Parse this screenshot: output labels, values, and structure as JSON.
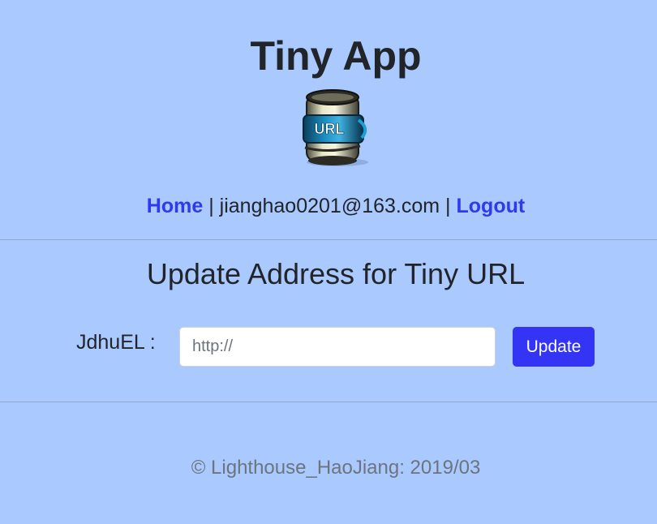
{
  "header": {
    "title": "Tiny App",
    "logo_icon": "url-barrel-icon",
    "logo_text": "URL"
  },
  "nav": {
    "home_label": "Home",
    "separator": "|",
    "user_email": "jianghao0201@163.com",
    "logout_label": "Logout"
  },
  "main": {
    "heading": "Update Address for Tiny URL",
    "short_url_label": "JdhuEL :",
    "url_input": {
      "value": "",
      "placeholder": "http://"
    },
    "update_button_label": "Update"
  },
  "footer": {
    "text": "© Lighthouse_HaoJiang: 2019/03"
  },
  "colors": {
    "background": "#a9c9ff",
    "link": "#2e3af0",
    "button": "#3434f5",
    "text": "#212529",
    "muted": "#6c757d"
  }
}
